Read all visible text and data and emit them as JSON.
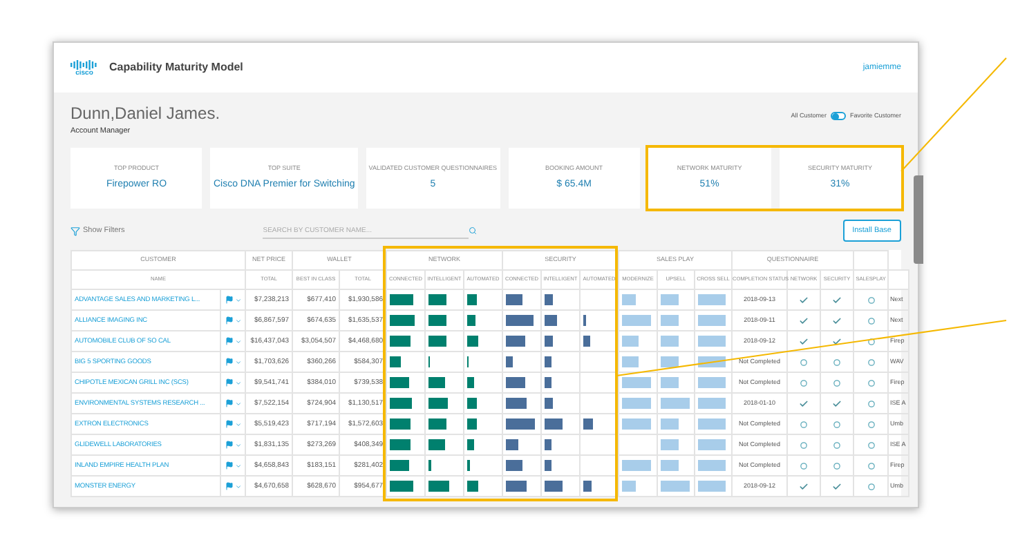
{
  "header": {
    "logo": "cisco",
    "title": "Capability Maturity Model",
    "user": "jamiemme"
  },
  "account": {
    "name": "Dunn,Daniel James.",
    "role": "Account Manager"
  },
  "filter_toggle": {
    "left_label": "All Customer",
    "right_label": "Favorite Customer",
    "on": false
  },
  "cards": [
    {
      "label": "TOP PRODUCT",
      "value": "Firepower RO",
      "highlighted": false
    },
    {
      "label": "TOP SUITE",
      "value": "Cisco DNA Premier for Switching",
      "highlighted": false
    },
    {
      "label": "VALIDATED CUSTOMER QUESTIONNAIRES",
      "value": "5",
      "highlighted": false
    },
    {
      "label": "BOOKING AMOUNT",
      "value": "$ 65.4M",
      "highlighted": false
    },
    {
      "label": "NETWORK MATURITY",
      "value": "51%",
      "highlighted": true
    },
    {
      "label": "SECURITY MATURITY",
      "value": "31%",
      "highlighted": true
    }
  ],
  "toolbar": {
    "filters": "Show Filters",
    "search": {
      "placeholder": "SEARCH BY CUSTOMER NAME..."
    },
    "install_base": "Install Base"
  },
  "table": {
    "groups": [
      {
        "label": "CUSTOMER"
      },
      {
        "label": "NET PRICE"
      },
      {
        "label": "WALLET"
      },
      {
        "label": "NETWORK"
      },
      {
        "label": "SECURITY"
      },
      {
        "label": "SALES PLAY"
      },
      {
        "label": "QUESTIONNAIRE"
      }
    ],
    "columns": [
      "NAME",
      "TOTAL",
      "BEST IN CLASS",
      "TOTAL",
      "CONNECTED",
      "INTELLIGENT",
      "AUTOMATED",
      "CONNECTED",
      "INTELLIGENT",
      "AUTOMATED",
      "MODERNIZE",
      "UPSELL",
      "CROSS SELL",
      "COMPLETION STATUS",
      "NETWORK",
      "SECURITY",
      "SALESPLAY"
    ],
    "rows": [
      {
        "name": "ADVANTAGE SALES AND MARKETING L...",
        "net_total": "$7,238,213",
        "best_in_class": "$677,410",
        "wallet_total": "$1,930,586",
        "network": {
          "connected": {
            "level": 0.75
          },
          "intelligent": {
            "level": 0.55
          },
          "automated": {
            "level": 0.3
          }
        },
        "security": {
          "connected": {
            "level": 0.5
          },
          "intelligent": {
            "level": 0.25
          }
        },
        "sales_play": {
          "modernize": {
            "level": 0.45
          },
          "upsell": {
            "level": 0.6
          },
          "cross_sell": {
            "level": 0.9
          }
        },
        "completion": "2018-09-13",
        "answers": [
          {
            "kind": "check"
          },
          {
            "kind": "check"
          },
          {
            "kind": "circle"
          }
        ],
        "column_19": "Next"
      },
      {
        "name": "ALLIANCE IMAGING INC",
        "net_total": "$6,867,597",
        "best_in_class": "$674,635",
        "wallet_total": "$1,635,537",
        "network": {
          "connected": {
            "level": 0.8
          },
          "intelligent": {
            "level": 0.55
          },
          "automated": {
            "level": 0.25
          }
        },
        "security": {
          "connected": {
            "level": 0.85
          },
          "intelligent": {
            "level": 0.4
          },
          "automated": {
            "level": 0.1
          }
        },
        "sales_play": {
          "modernize": {
            "level": 0.9
          },
          "upsell": {
            "level": 0.6
          },
          "cross_sell": {
            "level": 0.9
          }
        },
        "completion": "2018-09-11",
        "answers": [
          {
            "kind": "check"
          },
          {
            "kind": "check"
          },
          {
            "kind": "circle"
          }
        ],
        "column_19": "Next"
      },
      {
        "name": "AUTOMOBILE CLUB OF SO CAL",
        "net_total": "$16,437,043",
        "best_in_class": "$3,054,507",
        "wallet_total": "$4,468,680",
        "network": {
          "connected": {
            "level": 0.65
          },
          "intelligent": {
            "level": 0.55
          },
          "automated": {
            "level": 0.35
          }
        },
        "security": {
          "connected": {
            "level": 0.6
          },
          "intelligent": {
            "level": 0.25
          },
          "automated": {
            "level": 0.2
          }
        },
        "sales_play": {
          "modernize": {
            "level": 0.5
          },
          "upsell": {
            "level": 0.6
          },
          "cross_sell": {
            "level": 0.9
          }
        },
        "completion": "2018-09-12",
        "answers": [
          {
            "kind": "check"
          },
          {
            "kind": "check"
          },
          {
            "kind": "circle"
          }
        ],
        "column_19": "Firep"
      },
      {
        "name": "BIG 5 SPORTING GOODS",
        "net_total": "$1,703,626",
        "best_in_class": "$360,266",
        "wallet_total": "$584,307",
        "network": {
          "connected": {
            "level": 0.35
          },
          "intelligent": {
            "level": 0.05
          },
          "automated": {
            "level": 0.05
          }
        },
        "security": {
          "connected": {
            "level": 0.2
          },
          "intelligent": {
            "level": 0.2
          }
        },
        "sales_play": {
          "modernize": {
            "level": 0.5
          },
          "upsell": {
            "level": 0.6
          },
          "cross_sell": {
            "level": 0.9
          }
        },
        "completion": "Not Completed",
        "answers": [
          {
            "kind": "circle"
          },
          {
            "kind": "circle"
          },
          {
            "kind": "circle"
          }
        ],
        "column_19": "WAV"
      },
      {
        "name": "CHIPOTLE MEXICAN GRILL INC (SCS)",
        "net_total": "$9,541,741",
        "best_in_class": "$384,010",
        "wallet_total": "$739,538",
        "network": {
          "connected": {
            "level": 0.6
          },
          "intelligent": {
            "level": 0.5
          },
          "automated": {
            "level": 0.2
          }
        },
        "security": {
          "connected": {
            "level": 0.6
          },
          "intelligent": {
            "level": 0.2
          }
        },
        "sales_play": {
          "modernize": {
            "level": 0.9
          },
          "upsell": {
            "level": 0.6
          },
          "cross_sell": {
            "level": 0.9
          }
        },
        "completion": "Not Completed",
        "answers": [
          {
            "kind": "circle"
          },
          {
            "kind": "circle"
          },
          {
            "kind": "circle"
          }
        ],
        "column_19": "Firep"
      },
      {
        "name": "ENVIRONMENTAL SYSTEMS RESEARCH ...",
        "net_total": "$7,522,154",
        "best_in_class": "$724,904",
        "wallet_total": "$1,130,517",
        "network": {
          "connected": {
            "level": 0.7
          },
          "intelligent": {
            "level": 0.6
          },
          "automated": {
            "level": 0.3
          }
        },
        "security": {
          "connected": {
            "level": 0.65
          },
          "intelligent": {
            "level": 0.25
          }
        },
        "sales_play": {
          "modernize": {
            "level": 0.9
          },
          "upsell": {
            "level": 0.95
          },
          "cross_sell": {
            "level": 0.9
          }
        },
        "completion": "2018-01-10",
        "answers": [
          {
            "kind": "check"
          },
          {
            "kind": "check"
          },
          {
            "kind": "circle"
          }
        ],
        "column_19": "ISE A"
      },
      {
        "name": "EXTRON ELECTRONICS",
        "net_total": "$5,519,423",
        "best_in_class": "$717,194",
        "wallet_total": "$1,572,603",
        "network": {
          "connected": {
            "level": 0.65
          },
          "intelligent": {
            "level": 0.55
          },
          "automated": {
            "level": 0.3
          }
        },
        "security": {
          "connected": {
            "level": 0.9
          },
          "intelligent": {
            "level": 0.55
          },
          "automated": {
            "level": 0.3
          }
        },
        "sales_play": {
          "modernize": {
            "level": 0.9
          },
          "upsell": {
            "level": 0.6
          },
          "cross_sell": {
            "level": 0.9
          }
        },
        "completion": "Not Completed",
        "answers": [
          {
            "kind": "circle"
          },
          {
            "kind": "circle"
          },
          {
            "kind": "circle"
          }
        ],
        "column_19": "Umb"
      },
      {
        "name": "GLIDEWELL LABORATORIES",
        "net_total": "$1,831,135",
        "best_in_class": "$273,269",
        "wallet_total": "$408,349",
        "network": {
          "connected": {
            "level": 0.65
          },
          "intelligent": {
            "level": 0.5
          },
          "automated": {
            "level": 0.2
          }
        },
        "security": {
          "connected": {
            "level": 0.4
          },
          "intelligent": {
            "level": 0.2
          }
        },
        "sales_play": {
          "upsell": {
            "level": 0.6
          },
          "cross_sell": {
            "level": 0.9
          }
        },
        "completion": "Not Completed",
        "answers": [
          {
            "kind": "circle"
          },
          {
            "kind": "circle"
          },
          {
            "kind": "circle"
          }
        ],
        "column_19": "ISE A"
      },
      {
        "name": "INLAND EMPIRE HEALTH PLAN",
        "net_total": "$4,658,843",
        "best_in_class": "$183,151",
        "wallet_total": "$281,402",
        "network": {
          "connected": {
            "level": 0.6
          },
          "intelligent": {
            "level": 0.1
          },
          "automated": {
            "level": 0.1
          }
        },
        "security": {
          "connected": {
            "level": 0.5
          },
          "intelligent": {
            "level": 0.2
          }
        },
        "sales_play": {
          "modernize": {
            "level": 0.9
          },
          "upsell": {
            "level": 0.6
          },
          "cross_sell": {
            "level": 0.9
          }
        },
        "completion": "Not Completed",
        "answers": [
          {
            "kind": "circle"
          },
          {
            "kind": "circle"
          },
          {
            "kind": "circle"
          }
        ],
        "column_19": "Firep"
      },
      {
        "name": "MONSTER ENERGY",
        "net_total": "$4,670,658",
        "best_in_class": "$628,670",
        "wallet_total": "$954,677",
        "network": {
          "connected": {
            "level": 0.75
          },
          "intelligent": {
            "level": 0.65
          },
          "automated": {
            "level": 0.35
          }
        },
        "security": {
          "connected": {
            "level": 0.65
          },
          "intelligent": {
            "level": 0.55
          },
          "automated": {
            "level": 0.25
          }
        },
        "sales_play": {
          "modernize": {
            "level": 0.45
          },
          "upsell": {
            "level": 0.95
          },
          "cross_sell": {
            "level": 0.9
          }
        },
        "completion": "2018-09-12",
        "answers": [
          {
            "kind": "check"
          },
          {
            "kind": "check"
          },
          {
            "kind": "circle"
          }
        ],
        "column_19": "Umb"
      }
    ]
  }
}
